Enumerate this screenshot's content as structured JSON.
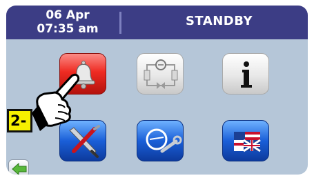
{
  "header": {
    "date": "06 Apr",
    "time": "07:35 am",
    "status": "STANDBY"
  },
  "tiles": [
    {
      "name": "alarm-bell",
      "icon": "bell-icon",
      "style": "red"
    },
    {
      "name": "refrigeration-circuit",
      "icon": "refrigeration-circuit-icon",
      "style": "grey"
    },
    {
      "name": "info",
      "icon": "info-icon",
      "style": "grey"
    },
    {
      "name": "service-tools",
      "icon": "tools-icon",
      "style": "blue"
    },
    {
      "name": "compressor-service",
      "icon": "compressor-wrench-icon",
      "style": "blue"
    },
    {
      "name": "language",
      "icon": "language-flag-icon",
      "style": "blue"
    }
  ],
  "annotation": {
    "step_label": "2-",
    "pointer": "hand-pointer-icon"
  },
  "colors": {
    "header_bg": "#3c3d85",
    "panel_bg": "#b5c6d8",
    "alarm_red": "#ef2b22",
    "tile_blue": "#1a5fd8",
    "step_yellow": "#f6f000"
  }
}
